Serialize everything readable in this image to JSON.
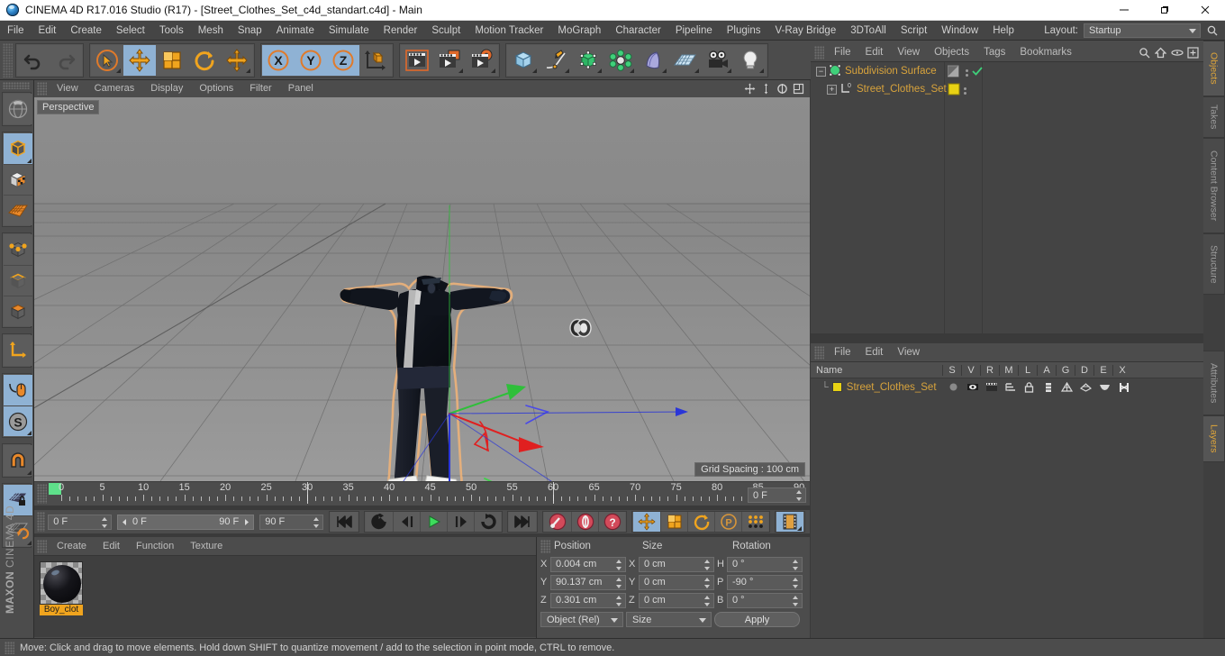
{
  "window": {
    "title": "CINEMA 4D R17.016 Studio (R17) - [Street_Clothes_Set_c4d_standart.c4d] - Main",
    "minimize": "─",
    "maximize": "❐",
    "close": "✕"
  },
  "menubar": {
    "items": [
      "File",
      "Edit",
      "Create",
      "Select",
      "Tools",
      "Mesh",
      "Snap",
      "Animate",
      "Simulate",
      "Render",
      "Sculpt",
      "Motion Tracker",
      "MoGraph",
      "Character",
      "Pipeline",
      "Plugins",
      "V-Ray Bridge",
      "3DToAll",
      "Script",
      "Window",
      "Help"
    ],
    "layout_label": "Layout:",
    "layout_value": "Startup"
  },
  "viewport": {
    "menu": [
      "View",
      "Cameras",
      "Display",
      "Options",
      "Filter",
      "Panel"
    ],
    "label": "Perspective",
    "grid_spacing": "Grid Spacing : 100 cm",
    "axis_x": "X",
    "axis_y": "Y",
    "axis_z": "Z"
  },
  "object_manager": {
    "menu": [
      "File",
      "Edit",
      "View",
      "Objects",
      "Tags",
      "Bookmarks"
    ],
    "rows": [
      {
        "name": "Subdivision Surface",
        "indent": 0
      },
      {
        "name": "Street_Clothes_Set",
        "indent": 1
      }
    ]
  },
  "layer_manager": {
    "menu": [
      "File",
      "Edit",
      "View"
    ],
    "columns": [
      "Name",
      "S",
      "V",
      "R",
      "M",
      "L",
      "A",
      "G",
      "D",
      "E",
      "X"
    ],
    "rows": [
      {
        "name": "Street_Clothes_Set"
      }
    ]
  },
  "timeline": {
    "ticks": [
      "0",
      "5",
      "10",
      "15",
      "20",
      "25",
      "30",
      "35",
      "40",
      "45",
      "50",
      "55",
      "60",
      "65",
      "70",
      "75",
      "80",
      "85",
      "90"
    ],
    "current_frame_right": "0 F",
    "start_field": "0 F",
    "range_start": "0 F",
    "range_end": "90 F",
    "end_field": "90 F"
  },
  "material_manager": {
    "menu": [
      "Create",
      "Edit",
      "Function",
      "Texture"
    ],
    "materials": [
      {
        "name": "Boy_clot"
      }
    ]
  },
  "coordinates": {
    "headers": [
      "Position",
      "Size",
      "Rotation"
    ],
    "rows": [
      {
        "plabel": "X",
        "pvalue": "0.004 cm",
        "slabel": "X",
        "svalue": "0 cm",
        "rlabel": "H",
        "rvalue": "0 °"
      },
      {
        "plabel": "Y",
        "pvalue": "90.137 cm",
        "slabel": "Y",
        "svalue": "0 cm",
        "rlabel": "P",
        "rvalue": "-90 °"
      },
      {
        "plabel": "Z",
        "pvalue": "0.301 cm",
        "slabel": "Z",
        "svalue": "0 cm",
        "rlabel": "B",
        "rvalue": "0 °"
      }
    ],
    "mode_combo": "Object (Rel)",
    "size_combo": "Size",
    "apply_label": "Apply"
  },
  "side_tabs": {
    "right_upper": [
      "Objects",
      "Takes",
      "Content Browser",
      "Structure"
    ],
    "right_lower": [
      "Attributes",
      "Layers"
    ]
  },
  "branding": {
    "maxon": "MAXON",
    "product": "CINEMA 4D"
  },
  "statusbar": {
    "text": "Move: Click and drag to move elements. Hold down SHIFT to quantize movement / add to the selection in point mode, CTRL to remove."
  },
  "colors": {
    "accent_orange": "#d8a33c",
    "selection_blue": "#8fb2d4",
    "panel_bg": "#4c4c4c",
    "viewport_bg": "#8a8a8a",
    "axis_x": "#e03030",
    "axis_y": "#30c040",
    "axis_z": "#3040e0"
  }
}
